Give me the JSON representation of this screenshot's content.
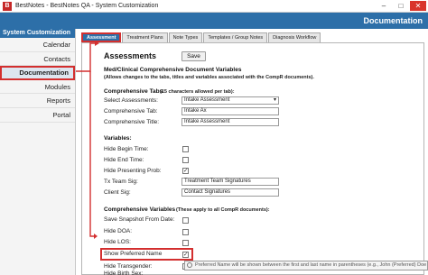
{
  "window": {
    "title": "BestNotes - BestNotes QA - System Customization",
    "logo_letter": "B"
  },
  "header": {
    "title": "Documentation"
  },
  "sidebar": {
    "header": "System Customization",
    "items": [
      {
        "label": "Calendar"
      },
      {
        "label": "Contacts"
      },
      {
        "label": "Documentation"
      },
      {
        "label": "Modules"
      },
      {
        "label": "Reports"
      },
      {
        "label": "Portal"
      }
    ]
  },
  "tabs": [
    {
      "label": "Assessment"
    },
    {
      "label": "Treatment Plans"
    },
    {
      "label": "Note Types"
    },
    {
      "label": "Templates / Group Notes"
    },
    {
      "label": "Diagnosis Workflow"
    }
  ],
  "assessments": {
    "title": "Assessments",
    "save_label": "Save",
    "doc_vars_title": "Med/Clinical Comprehensive Document Variables",
    "doc_vars_desc": "(Allows changes to the tabs, titles and variables associated with the CompR documents).",
    "tabs_title": "Comprehensive Tabs",
    "tabs_note": "(15 characters allowed per tab):",
    "select_label": "Select Assessments:",
    "select_value": "Intake Assessment",
    "comp_tab_label": "Comprehensive Tab:",
    "comp_tab_value": "Intake Ax",
    "comp_title_label": "Comprehensive Title:",
    "comp_title_value": "Intake Assessment",
    "variables_title": "Variables:",
    "hide_begin_label": "Hide Begin Time:",
    "hide_end_label": "Hide End Time:",
    "hide_presenting_label": "Hide Presenting Prob:",
    "tx_team_label": "Tx Team Sig:",
    "tx_team_value": "Treatment Team Signatures",
    "client_sig_label": "Client Sig:",
    "client_sig_value": "Contact Signatures",
    "comp_vars_title": "Comprehensive Variables",
    "comp_vars_note": "(These apply to all CompR documents):",
    "save_snapshot_label": "Save Snapshot From Date:",
    "hide_doa_label": "Hide DOA:",
    "hide_los_label": "Hide LOS:",
    "show_preferred_label": "Show Preferred Name",
    "hide_transgender_label": "Hide Transgender:",
    "hide_birth_sex_label": "Hide Birth Sex:",
    "tooltip": "Preferred Name will be shown between the first and last name in parentheses (e.g., John (Preferred) Doe"
  },
  "checked": {
    "hide_begin": false,
    "hide_end": false,
    "hide_presenting": true,
    "save_snapshot": false,
    "hide_doa": false,
    "hide_los": false,
    "show_preferred": true,
    "hide_transgender": false
  },
  "icons": {
    "checkmark": "✓",
    "select_arrow": "▾",
    "minimize": "–",
    "maximize": "□",
    "close": "✕"
  },
  "colors": {
    "brand_blue": "#2d6fa8",
    "highlight_red": "#d32f2f"
  }
}
